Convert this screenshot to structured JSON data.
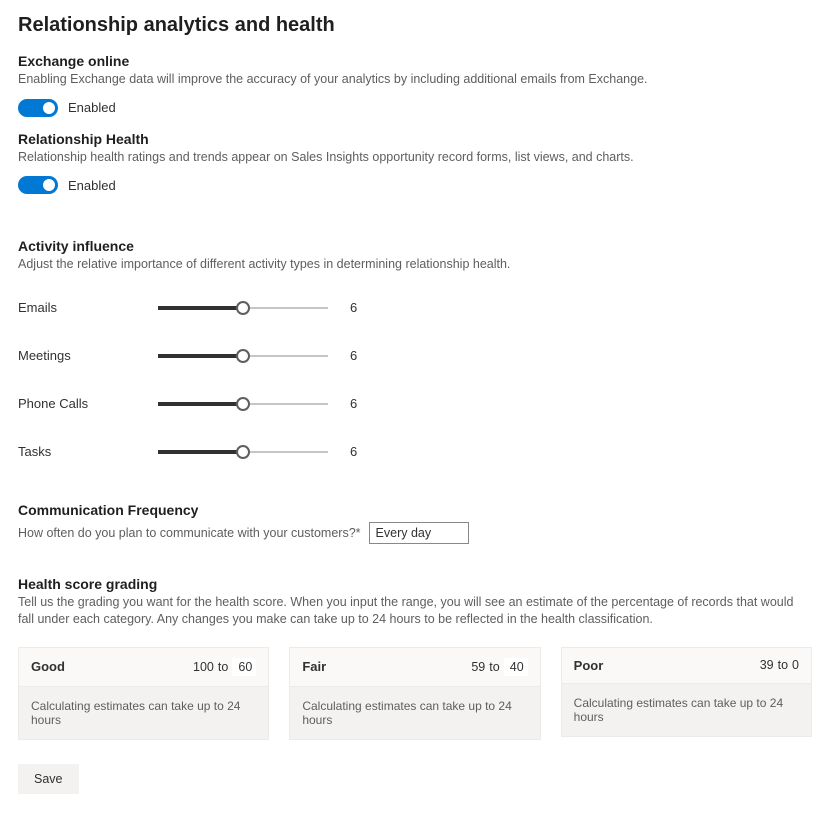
{
  "title": "Relationship analytics and health",
  "exchange": {
    "heading": "Exchange online",
    "desc": "Enabling Exchange data will improve the accuracy of your analytics by including additional emails from Exchange.",
    "toggle_label": "Enabled"
  },
  "relationship_health": {
    "heading": "Relationship Health",
    "desc": "Relationship health ratings and trends appear on Sales Insights opportunity record forms, list views, and charts.",
    "toggle_label": "Enabled"
  },
  "activity_influence": {
    "heading": "Activity influence",
    "desc": "Adjust the relative importance of different activity types in determining relationship health.",
    "sliders": [
      {
        "label": "Emails",
        "value": "6",
        "percent": 50
      },
      {
        "label": "Meetings",
        "value": "6",
        "percent": 50
      },
      {
        "label": "Phone Calls",
        "value": "6",
        "percent": 50
      },
      {
        "label": "Tasks",
        "value": "6",
        "percent": 50
      }
    ]
  },
  "communication_frequency": {
    "heading": "Communication Frequency",
    "label": "How often do you plan to communicate with your customers?*",
    "value": "Every day"
  },
  "health_grading": {
    "heading": "Health score grading",
    "desc": "Tell us the grading you want for the health score. When you input the range, you will see an estimate of the percentage of records that would fall under each category. Any changes you make can take up to 24 hours to be reflected in the health classification.",
    "to_word": "to",
    "grades": [
      {
        "name": "Good",
        "from": "100",
        "to": "60",
        "editable_to": true,
        "estimate": "Calculating estimates can take up to 24 hours"
      },
      {
        "name": "Fair",
        "from": "59",
        "to": "40",
        "editable_to": true,
        "estimate": "Calculating estimates can take up to 24 hours"
      },
      {
        "name": "Poor",
        "from": "39",
        "to": "0",
        "editable_to": false,
        "estimate": "Calculating estimates can take up to 24 hours"
      }
    ]
  },
  "save_label": "Save"
}
